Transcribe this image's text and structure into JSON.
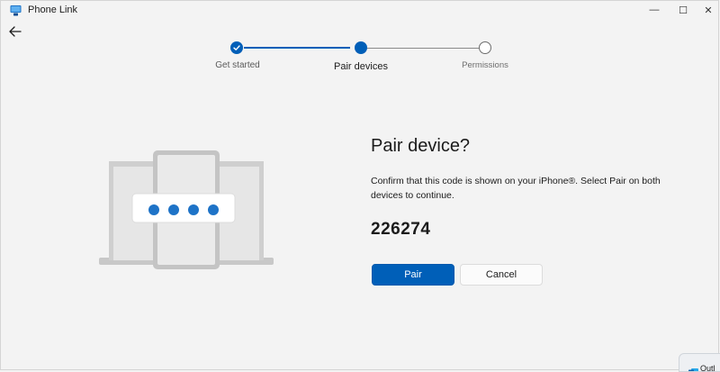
{
  "app": {
    "title": "Phone Link",
    "accent_color": "#005fb8"
  },
  "titlebar": {
    "minimize_glyph": "—",
    "maximize_glyph": "☐",
    "close_glyph": "✕"
  },
  "stepper": {
    "steps": [
      {
        "label": "Get started",
        "state": "completed"
      },
      {
        "label": "Pair devices",
        "state": "current"
      },
      {
        "label": "Permissions",
        "state": "upcoming"
      }
    ]
  },
  "illustration": {
    "icon": "devices-pairing-illustration",
    "dot_count": 4
  },
  "pair": {
    "title": "Pair device?",
    "description": "Confirm that this code is shown on your iPhone®. Select Pair on both devices to continue.",
    "code": "226274",
    "pair_label": "Pair",
    "cancel_label": "Cancel"
  },
  "notification": {
    "label": "Outl",
    "icon": "outlook-icon"
  }
}
